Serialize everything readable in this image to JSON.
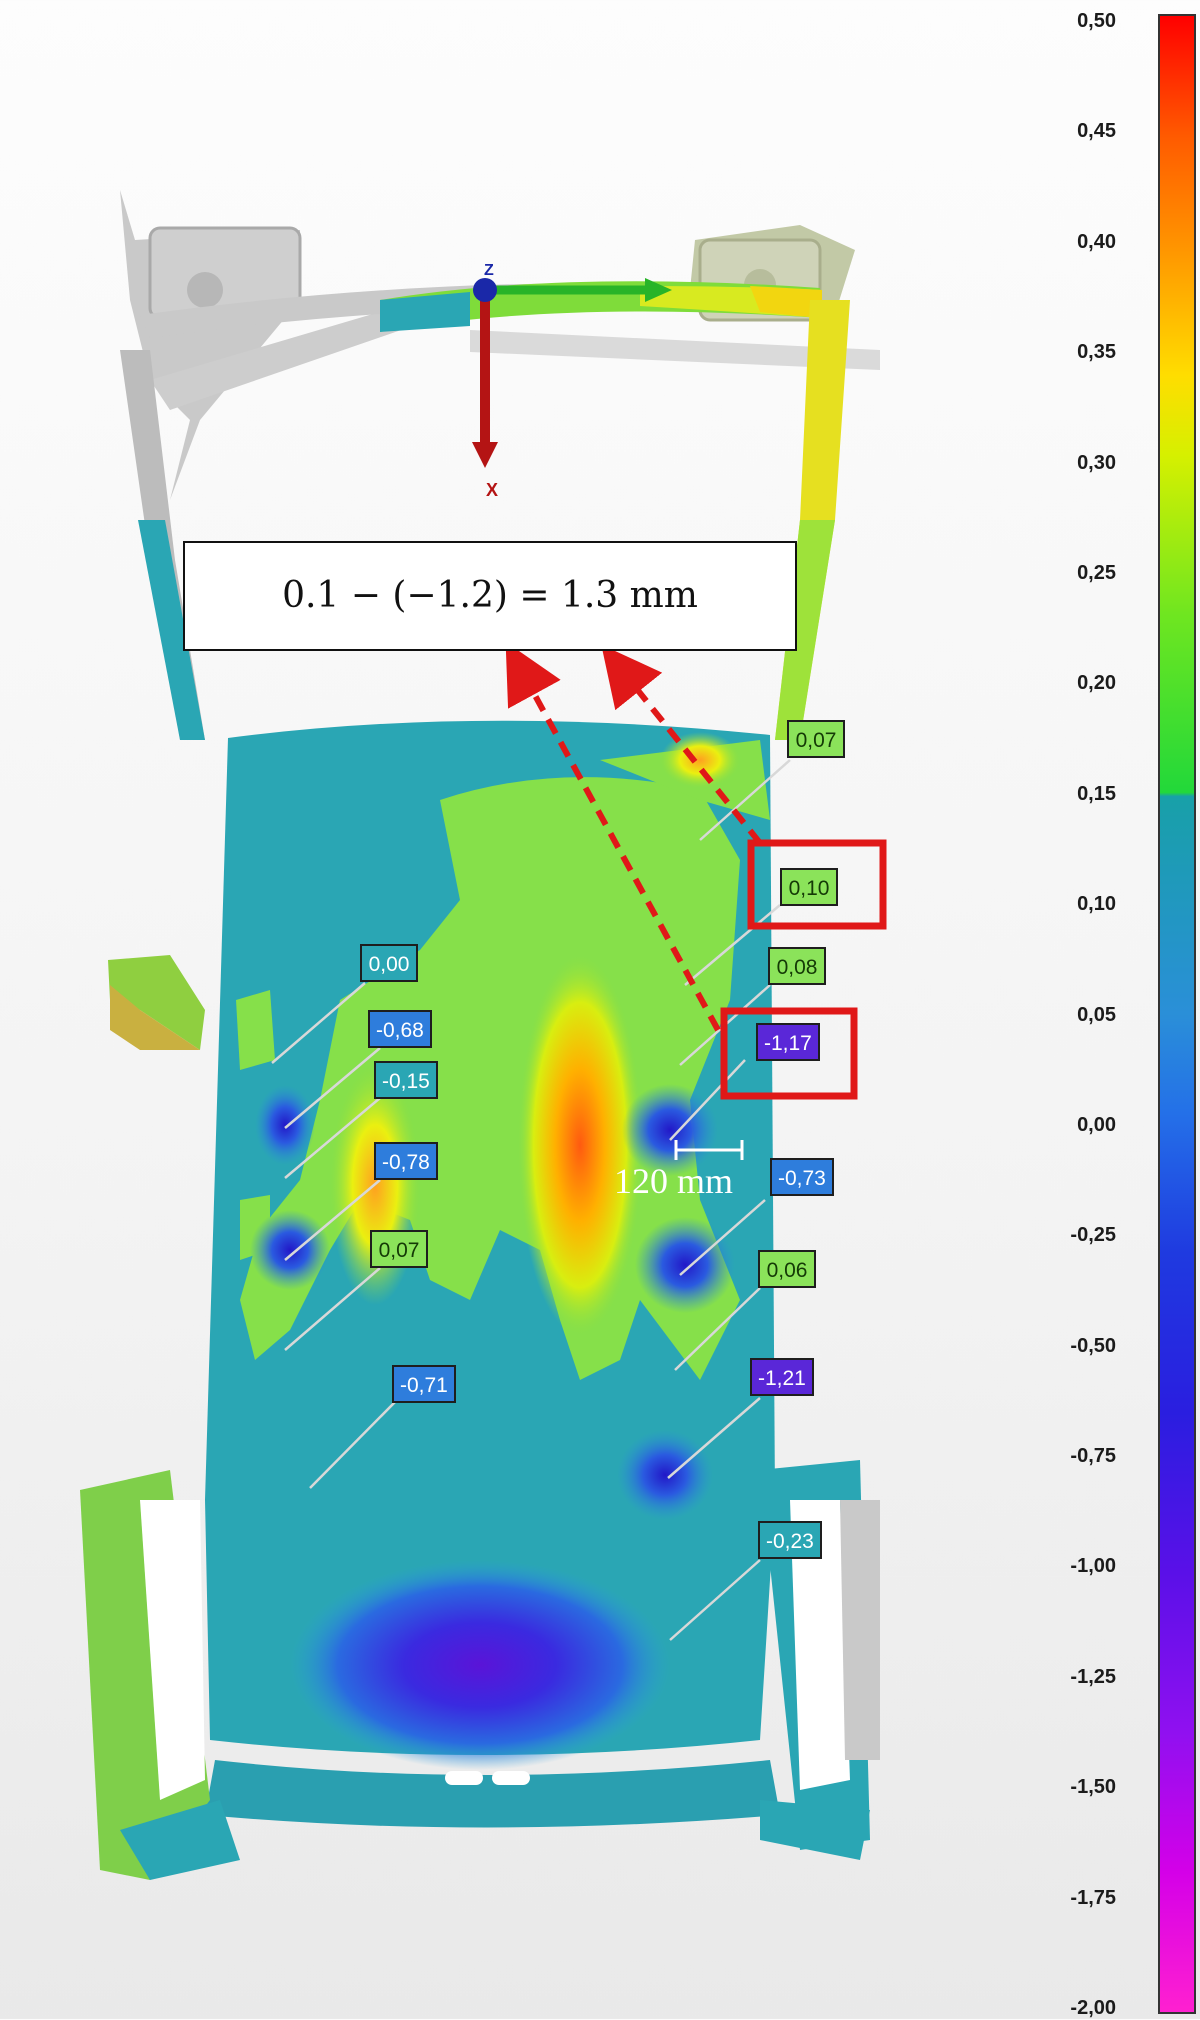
{
  "formula": "0.1 − (−1.2) = 1.3 mm",
  "scale_note": "120 mm",
  "axes": {
    "z": "Z",
    "x": "X"
  },
  "labels": [
    {
      "text": "0,07",
      "tone": "green"
    },
    {
      "text": "0,10",
      "tone": "green"
    },
    {
      "text": "0,08",
      "tone": "green"
    },
    {
      "text": "-1,17",
      "tone": "purple"
    },
    {
      "text": "0,00",
      "tone": "teal"
    },
    {
      "text": "-0,68",
      "tone": "blue"
    },
    {
      "text": "-0,15",
      "tone": "teal"
    },
    {
      "text": "-0,78",
      "tone": "blue"
    },
    {
      "text": "0,07",
      "tone": "green"
    },
    {
      "text": "-0,73",
      "tone": "blue"
    },
    {
      "text": "0,06",
      "tone": "green"
    },
    {
      "text": "-1,21",
      "tone": "purple"
    },
    {
      "text": "-0,71",
      "tone": "blue"
    },
    {
      "text": "-0,23",
      "tone": "teal"
    }
  ],
  "colorbar": {
    "ticks": [
      "0,50",
      "0,45",
      "0,40",
      "0,35",
      "0,30",
      "0,25",
      "0,20",
      "0,15",
      "0,10",
      "0,05",
      "0,00",
      "-0,25",
      "-0,50",
      "-0,75",
      "-1,00",
      "-1,25",
      "-1,50",
      "-1,75",
      "-2,00"
    ],
    "max": 0.5,
    "min": -2.0
  },
  "colors": {
    "highlight": "#e01818",
    "arrow": "#e01818"
  }
}
